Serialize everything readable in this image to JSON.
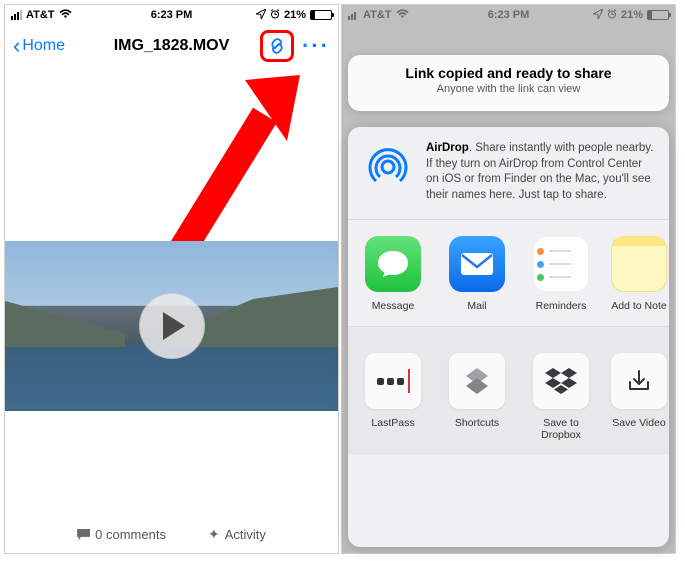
{
  "status": {
    "carrier": "AT&T",
    "time": "6:23 PM",
    "battery": "21%"
  },
  "nav": {
    "back": "Home",
    "title": "IMG_1828.MOV",
    "more": "···"
  },
  "footer": {
    "comments": "0 comments",
    "activity": "Activity"
  },
  "share": {
    "toast_title": "Link copied and ready to share",
    "toast_sub": "Anyone with the link can view",
    "airdrop_bold": "AirDrop",
    "airdrop_text": ". Share instantly with people nearby. If they turn on AirDrop from Control Center on iOS or from Finder on the Mac, you'll see their names here. Just tap to share."
  },
  "apps": {
    "message": "Message",
    "mail": "Mail",
    "reminders": "Reminders",
    "notes": "Add to Note"
  },
  "actions": {
    "lastpass": "LastPass",
    "shortcuts": "Shortcuts",
    "dropbox": "Save to\nDropbox",
    "savevideo": "Save Video"
  }
}
